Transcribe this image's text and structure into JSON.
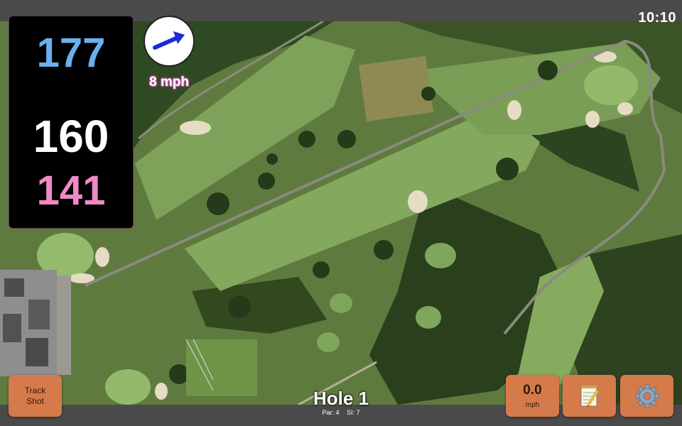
{
  "status": {
    "clock": "10:10"
  },
  "yardage": {
    "back": "177",
    "middle": "160",
    "front": "141"
  },
  "wind": {
    "speed": "8 mph",
    "direction_icon": "arrow-northeast-icon"
  },
  "hole": {
    "title": "Hole 1",
    "par": "Par: 4",
    "si": "SI: 7"
  },
  "buttons": {
    "track_line1": "Track",
    "track_line2": "Shot",
    "speed_value": "0.0",
    "speed_unit": "mph",
    "notes_icon": "notepad-icon",
    "settings_icon": "gear-icon"
  },
  "colors": {
    "back": "#6ab0ee",
    "middle": "#ffffff",
    "front": "#f08ac6",
    "button": "#d57a4a"
  }
}
